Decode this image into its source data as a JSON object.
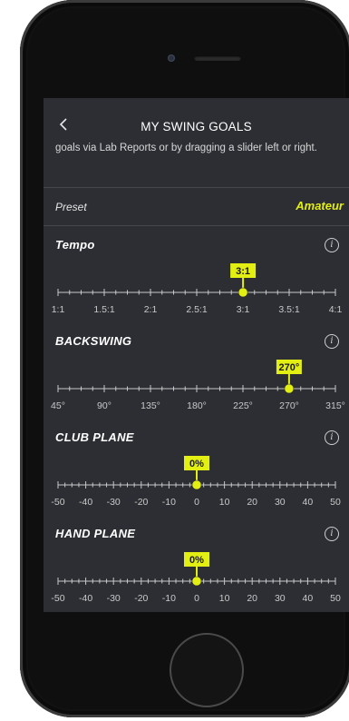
{
  "header": {
    "title": "MY SWING GOALS"
  },
  "description": "goals via Lab Reports or by dragging a slider left or right.",
  "preset": {
    "label": "Preset",
    "value": "Amateur"
  },
  "sliders": [
    {
      "id": "tempo",
      "title": "Tempo",
      "labels": [
        "1:1",
        "1.5:1",
        "2:1",
        "2.5:1",
        "3:1",
        "3.5:1",
        "4:1"
      ],
      "value_label": "3:1",
      "value_fraction": 0.667
    },
    {
      "id": "backswing",
      "title": "BACKSWING",
      "labels": [
        "45°",
        "90°",
        "135°",
        "180°",
        "225°",
        "270°",
        "315°"
      ],
      "value_label": "270°",
      "value_fraction": 0.833
    },
    {
      "id": "club-plane",
      "title": "CLUB PLANE",
      "labels": [
        "-50",
        "-40",
        "-30",
        "-20",
        "-10",
        "0",
        "10",
        "20",
        "30",
        "40",
        "50"
      ],
      "value_label": "0%",
      "value_fraction": 0.5
    },
    {
      "id": "hand-plane",
      "title": "HAND PLANE",
      "labels": [
        "-50",
        "-40",
        "-30",
        "-20",
        "-10",
        "0",
        "10",
        "20",
        "30",
        "40",
        "50"
      ],
      "value_label": "0%",
      "value_fraction": 0.5
    }
  ],
  "colors": {
    "accent": "#e3ee12",
    "background": "#2c2e33",
    "text": "#f2f2f2"
  },
  "icons": {
    "back": "chevron-left-icon",
    "info": "info-icon"
  }
}
